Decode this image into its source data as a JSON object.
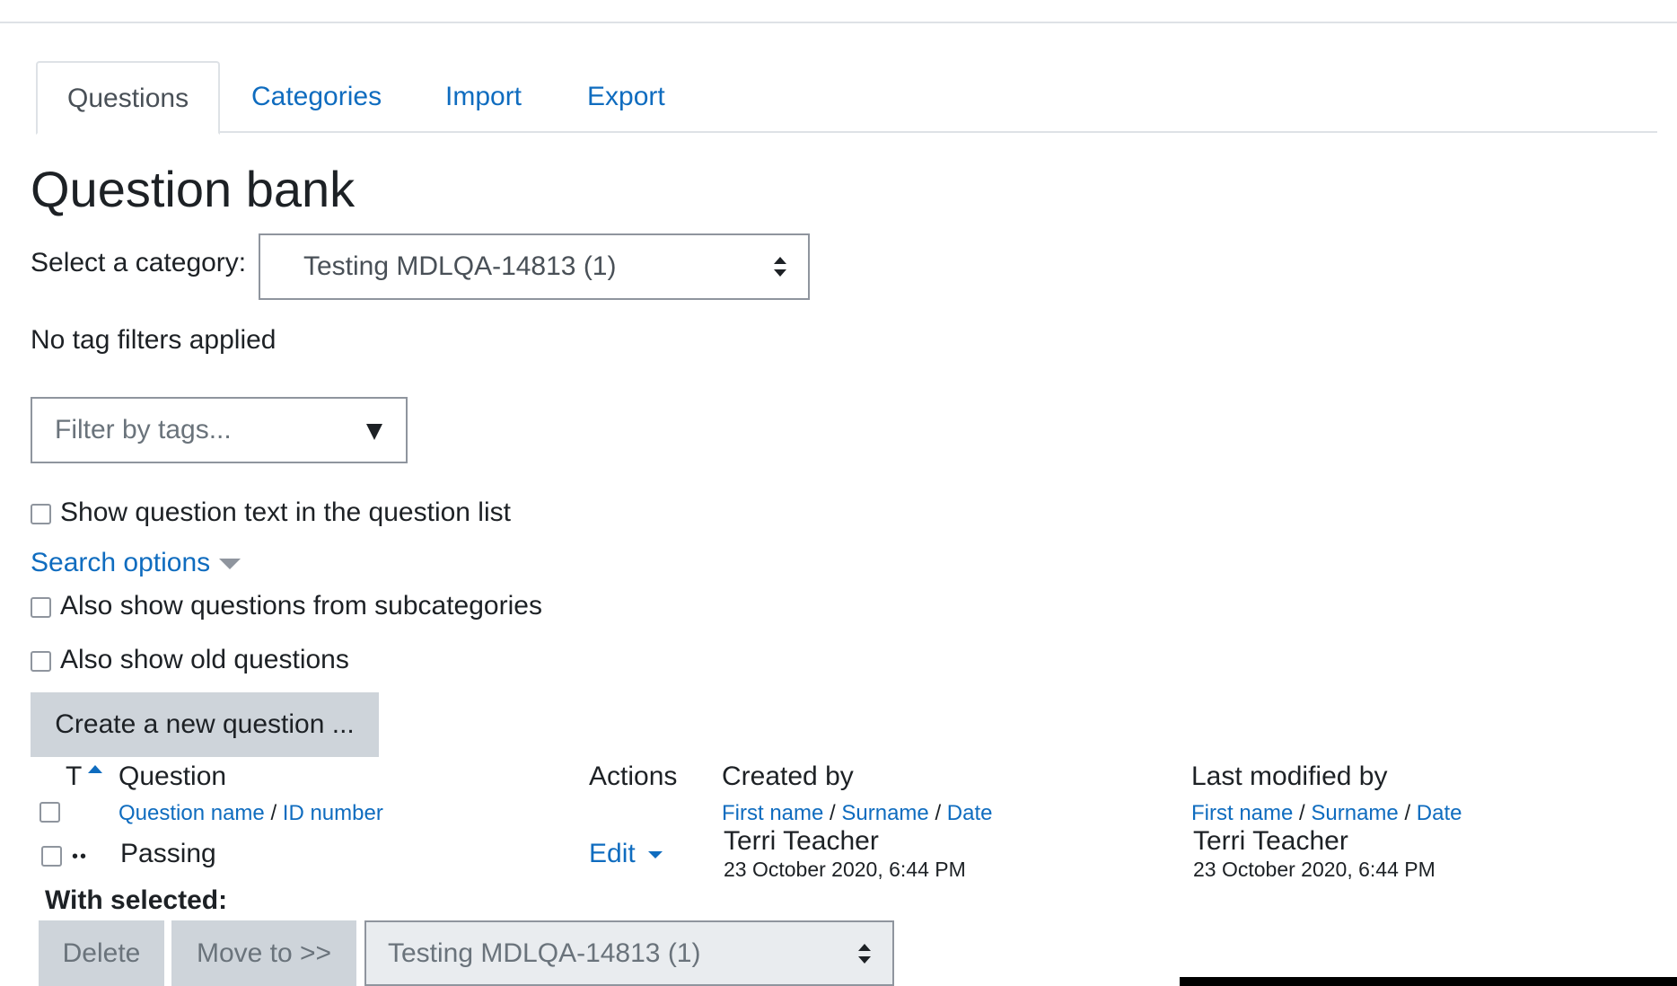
{
  "tabs": [
    {
      "label": "Questions"
    },
    {
      "label": "Categories"
    },
    {
      "label": "Import"
    },
    {
      "label": "Export"
    }
  ],
  "page_title": "Question bank",
  "category": {
    "label": "Select a category:",
    "selected": "Testing MDLQA-14813 (1)"
  },
  "tags": {
    "status": "No tag filters applied",
    "placeholder": "Filter by tags..."
  },
  "options": {
    "show_text": "Show question text in the question list",
    "search_options": "Search options",
    "subcategories": "Also show questions from subcategories",
    "old_questions": "Also show old questions"
  },
  "create_button": "Create a new question ...",
  "table": {
    "headers": {
      "type": "T",
      "question": "Question",
      "actions": "Actions",
      "created_by": "Created by",
      "last_modified_by": "Last modified by"
    },
    "subheaders": {
      "question_name": "Question name",
      "id_number": "ID number",
      "first_name": "First name",
      "surname": "Surname",
      "date": "Date",
      "sep": "/"
    },
    "rows": [
      {
        "type_icon": "••",
        "question": "Passing",
        "action": "Edit",
        "created_by_name": "Terri Teacher",
        "created_date": "23 October 2020, 6:44 PM",
        "modified_by_name": "Terri Teacher",
        "modified_date": "23 October 2020, 6:44 PM"
      }
    ]
  },
  "bulk": {
    "label": "With selected:",
    "delete": "Delete",
    "move": "Move to >>",
    "target": "Testing MDLQA-14813 (1)"
  },
  "colors": {
    "link": "#0f6cbf",
    "button_bg": "#ced4da",
    "text": "#1d2125"
  }
}
